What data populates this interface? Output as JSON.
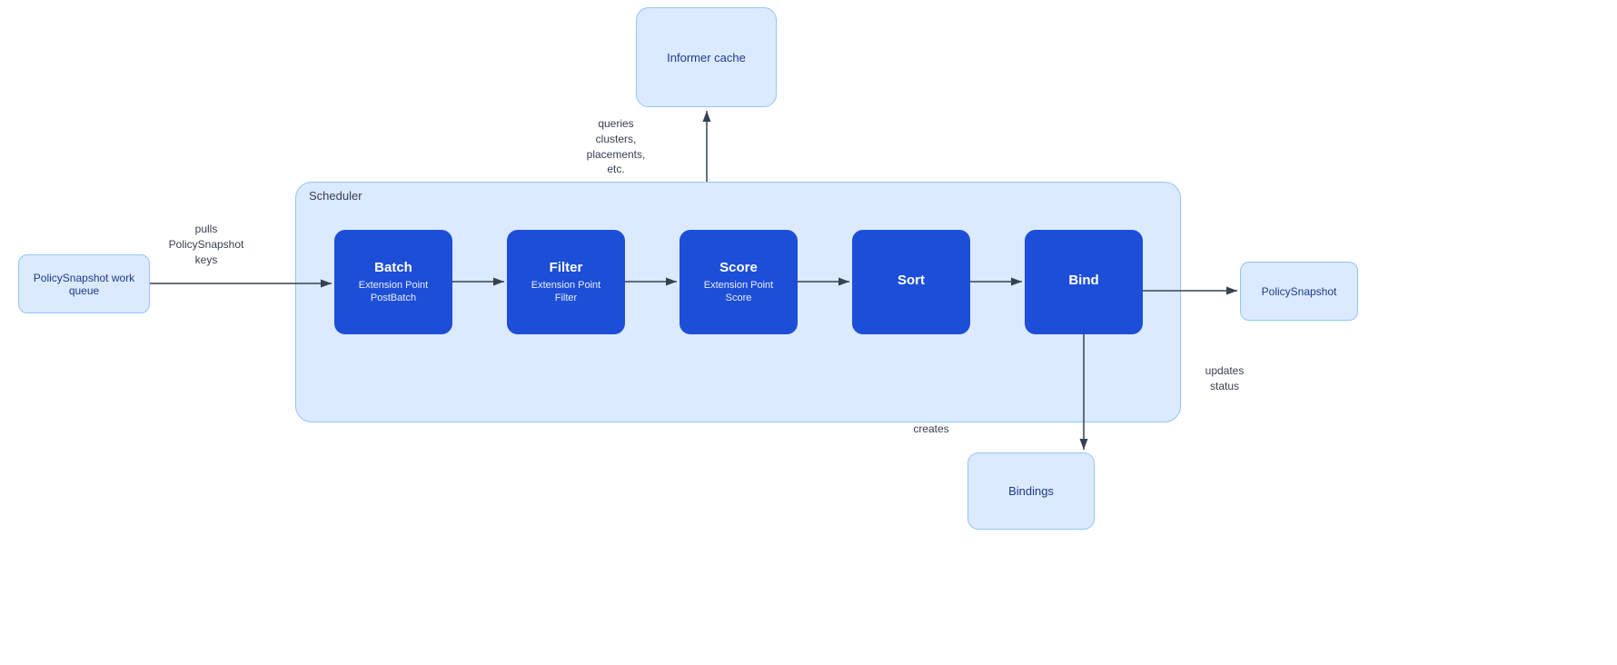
{
  "informer_cache": {
    "label": "Informer cache"
  },
  "scheduler": {
    "label": "Scheduler"
  },
  "steps": [
    {
      "id": "batch",
      "title": "Batch",
      "subtitle": "Extension Point\nPostBatch"
    },
    {
      "id": "filter",
      "title": "Filter",
      "subtitle": "Extension Point\nFilter"
    },
    {
      "id": "score",
      "title": "Score",
      "subtitle": "Extension Point\nScore"
    },
    {
      "id": "sort",
      "title": "Sort",
      "subtitle": ""
    },
    {
      "id": "bind",
      "title": "Bind",
      "subtitle": ""
    }
  ],
  "policy_queue": {
    "label": "PolicySnapshot work queue"
  },
  "policy_snapshot_out": {
    "label": "PolicySnapshot"
  },
  "bindings": {
    "label": "Bindings"
  },
  "labels": {
    "queries": "queries\nclusters,\nplacements,\netc.",
    "pulls": "pulls\nPolicySnapshot\nkeys",
    "creates": "creates",
    "updates": "updates\nstatus"
  }
}
